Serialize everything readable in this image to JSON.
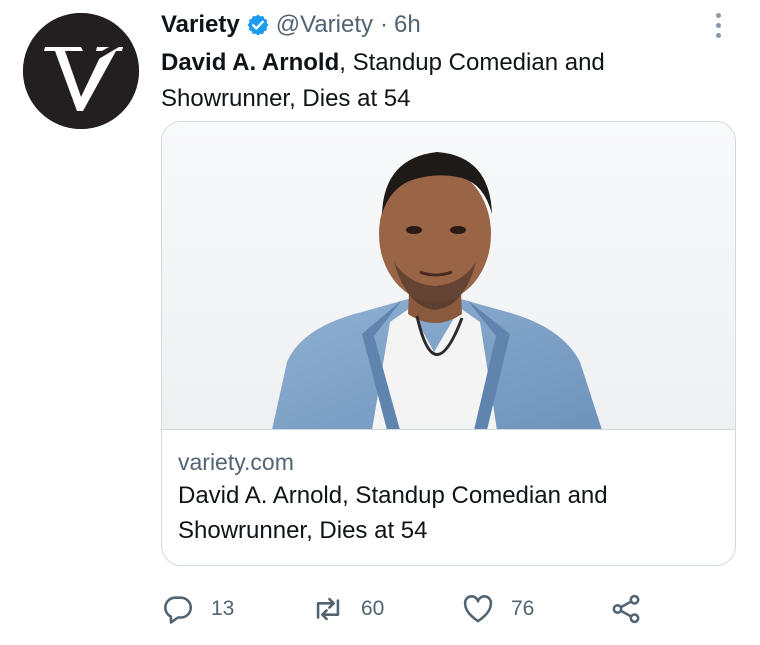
{
  "author": {
    "name": "Variety",
    "handle": "@Variety",
    "separator": "·",
    "time": "6h",
    "avatar_icon": "variety-logo",
    "verified_icon": "verified-badge-icon",
    "verified_color": "#1d9bf0"
  },
  "tweet": {
    "text_bold": "David A. Arnold",
    "text_rest": ", Standup Comedian and Showrunner, Dies at 54"
  },
  "card": {
    "domain": "variety.com",
    "title": "David A. Arnold, Standup Comedian and Showrunner, Dies at 54"
  },
  "actions": {
    "reply": {
      "icon": "reply-icon",
      "count": "13"
    },
    "retweet": {
      "icon": "retweet-icon",
      "count": "60"
    },
    "like": {
      "icon": "heart-icon",
      "count": "76"
    },
    "share": {
      "icon": "share-icon"
    }
  },
  "colors": {
    "text_primary": "#0f1419",
    "text_secondary": "#536471",
    "border": "#cfd9de"
  }
}
